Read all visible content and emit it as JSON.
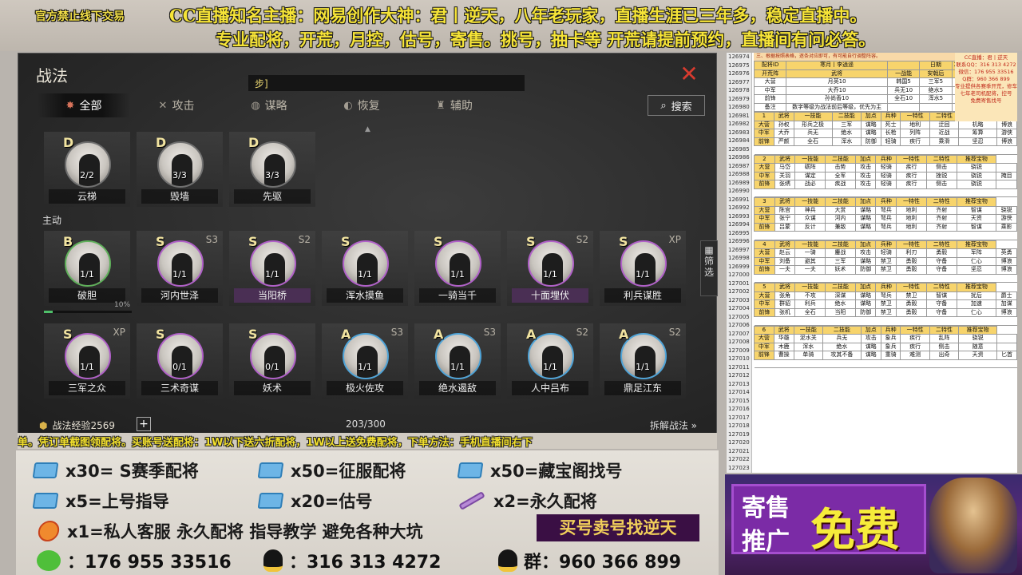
{
  "banner": {
    "small": "官方禁止线下交易",
    "line1": "CC直播知名主播：网易创作大神：君丨逆天，八年老玩家，直播生涯已三年多，稳定直播中。",
    "line2": "专业配将，开荒，月控，估号，寄售。挑号，抽卡等   开荒请提前预约，直播间有问必答。"
  },
  "game": {
    "title": "战法",
    "search_value": "步]",
    "tabs": [
      {
        "label": "全部",
        "icon": "all-icon"
      },
      {
        "label": "攻击",
        "icon": "swords-icon"
      },
      {
        "label": "谋略",
        "icon": "scroll-icon"
      },
      {
        "label": "恢复",
        "icon": "heal-icon"
      },
      {
        "label": "辅助",
        "icon": "support-icon"
      }
    ],
    "search_label": "搜索",
    "section_label": "主动",
    "filter_label": "筛选",
    "top_cards": [
      {
        "grade": "D",
        "count": "2/2",
        "name": "云梯"
      },
      {
        "grade": "D",
        "count": "3/3",
        "name": "毁墙"
      },
      {
        "grade": "D",
        "count": "3/3",
        "name": "先驱"
      }
    ],
    "row1": [
      {
        "grade": "B",
        "season": "",
        "count": "1/1",
        "name": "破胆",
        "progress": "10%"
      },
      {
        "grade": "S",
        "season": "S3",
        "count": "1/1",
        "name": "河内世泽"
      },
      {
        "grade": "S",
        "season": "S2",
        "count": "1/1",
        "name": "当阳桥"
      },
      {
        "grade": "S",
        "season": "",
        "count": "1/1",
        "name": "浑水摸鱼"
      },
      {
        "grade": "S",
        "season": "",
        "count": "1/1",
        "name": "一骑当千"
      },
      {
        "grade": "S",
        "season": "S2",
        "count": "1/1",
        "name": "十面埋伏"
      },
      {
        "grade": "S",
        "season": "XP",
        "count": "1/1",
        "name": "利兵谋胜"
      }
    ],
    "row2": [
      {
        "grade": "S",
        "season": "XP",
        "count": "1/1",
        "name": "三军之众"
      },
      {
        "grade": "S",
        "season": "",
        "count": "0/1",
        "name": "三术奇谋"
      },
      {
        "grade": "S",
        "season": "",
        "count": "0/1",
        "name": "妖术"
      },
      {
        "grade": "A",
        "season": "S3",
        "count": "1/1",
        "name": "极火佐攻"
      },
      {
        "grade": "A",
        "season": "S3",
        "count": "1/1",
        "name": "绝水遏敌"
      },
      {
        "grade": "A",
        "season": "S2",
        "count": "1/1",
        "name": "人中吕布"
      },
      {
        "grade": "A",
        "season": "S2",
        "count": "1/1",
        "name": "鼎足江东"
      }
    ],
    "exp_label": "战法经验2569",
    "capacity": "203/300",
    "dismantle": "拆解战法 »"
  },
  "ticker": "单。凭订单截图领配将。买账号送配将：1W以下送六折配将，1W以上送免费配将，下单方法：手机直播间右下",
  "promo": {
    "r1a": "x30= S赛季配将",
    "r1b": "x50=征服配将",
    "r1c": "x50=藏宝阁找号",
    "r2a": "x5=上号指导",
    "r2b": "x20=估号",
    "r2c": "x2=永久配将",
    "r3": "x1=私人客服 永久配将  指导教学 避免各种大坑",
    "badge": "买号卖号找逆天",
    "wechat": "：176 955 33516",
    "qq": "：316 313 4272",
    "group": "群：960 366 899"
  },
  "sheet": {
    "hdr": "三、根据按照表格，逐条对应即可，有可能自行调整阵容。",
    "rownums": [
      "126974",
      "126975",
      "126976",
      "126977",
      "126978",
      "126979",
      "126980",
      "126981",
      "126982",
      "126983",
      "126984",
      "126985",
      "126986",
      "126987",
      "126988",
      "126989",
      "126990",
      "126991",
      "126992",
      "126993",
      "126994",
      "126995",
      "126996",
      "126997",
      "126998",
      "126999",
      "127000",
      "127001",
      "127002",
      "127003",
      "127004",
      "127005",
      "127006",
      "127007",
      "127008",
      "127009",
      "127010",
      "127011",
      "127012",
      "127013",
      "127014",
      "127015",
      "127016",
      "127017",
      "127018",
      "127019",
      "127020",
      "127021",
      "127022",
      "127023"
    ],
    "promo_lines": [
      "CC直播：君丨逆天",
      "联系QQ：316 313 4272",
      "微信：176 955 33516",
      "Q群：960 366 899",
      "专业提供各赛季开荒，修车",
      "七年老司机配将，控号",
      "免费寄售找号"
    ],
    "top": [
      [
        "配将ID",
        "寒月丨李逍遥",
        "",
        "日期",
        "2023.4.21",
        ""
      ],
      [
        "开荒阵",
        "武将",
        "一战能",
        "安戟后",
        "加点",
        "赛季"
      ],
      [
        "大营",
        "月英10",
        "韩国5",
        "三军5",
        "谋略",
        ""
      ],
      [
        "中军",
        "大乔10",
        "兵无10",
        "绝水5",
        "谋略",
        "征服"
      ],
      [
        "前锋",
        "孙尚香10",
        "全石10",
        "浑水5",
        "防御",
        ""
      ],
      [
        "备注",
        "数字等级为战法前后等级，优先为主",
        "",
        "",
        "",
        ""
      ]
    ],
    "teams": [
      {
        "n": "1",
        "rows": [
          [
            "大营",
            "孙权",
            "形兵之极",
            "三军",
            "谋略",
            "死士",
            "地利",
            "迂回",
            "机略",
            "博浪"
          ],
          [
            "中军",
            "大乔",
            "兵无",
            "绝水",
            "谋略",
            "长枪",
            "列阵",
            "近战",
            "筹算",
            "游侠"
          ],
          [
            "前锋",
            "严颜",
            "全石",
            "浑水",
            "防御",
            "轻骑",
            "疾行",
            "乘滑",
            "坚忍",
            "博浪"
          ]
        ]
      },
      {
        "n": "2",
        "rows": [
          [
            "大营",
            "马岱",
            "砺阵",
            "击势",
            "攻击",
            "轻骑",
            "疾行",
            "侧击",
            "骁锐",
            ""
          ],
          [
            "中军",
            "关羽",
            "谋定",
            "全军",
            "攻击",
            "轻骑",
            "疾行",
            "挫锐",
            "骁锐",
            "掩目"
          ],
          [
            "前锋",
            "张绣",
            "战必",
            "疾战",
            "攻击",
            "轻骑",
            "疾行",
            "侧击",
            "骁锐",
            ""
          ]
        ]
      },
      {
        "n": "3",
        "rows": [
          [
            "大营",
            "陈宫",
            "神兵",
            "大赏",
            "谋略",
            "弩兵",
            "地利",
            "齐射",
            "智谋",
            "骁锐"
          ],
          [
            "中军",
            "张宁",
            "众谋",
            "河内",
            "谋略",
            "弩兵",
            "地利",
            "齐射",
            "天资",
            "游侠"
          ],
          [
            "前锋",
            "吕蒙",
            "反计",
            "兼敌",
            "谋略",
            "弩兵",
            "地利",
            "齐射",
            "智谋",
            "乘影"
          ]
        ]
      },
      {
        "n": "4",
        "rows": [
          [
            "大营",
            "赵云",
            "一骑",
            "鏖战",
            "攻击",
            "轻骑",
            "利刃",
            "勇毅",
            "军阵",
            "英勇"
          ],
          [
            "中军",
            "刘备",
            "避其",
            "三军",
            "谋略",
            "禁卫",
            "勇毅",
            "守备",
            "仁心",
            "博浪"
          ],
          [
            "前锋",
            "一夫",
            "一夫",
            "妖术",
            "防御",
            "禁卫",
            "勇毅",
            "守备",
            "坚忍",
            "博浪"
          ]
        ]
      },
      {
        "n": "5",
        "rows": [
          [
            "大营",
            "张角",
            "不攻",
            "深谋",
            "谋略",
            "弩兵",
            "禁卫",
            "智谋",
            "扰后",
            "爵士"
          ],
          [
            "中军",
            "群貂",
            "利兵",
            "绝水",
            "谋略",
            "禁卫",
            "勇毅",
            "守备",
            "加速",
            "加谋"
          ],
          [
            "前锋",
            "张机",
            "全石",
            "当阳",
            "防御",
            "禁卫",
            "勇毅",
            "守备",
            "仁心",
            "博浪"
          ]
        ]
      },
      {
        "n": "6",
        "rows": [
          [
            "大营",
            "华雄",
            "泥水关",
            "兵无",
            "攻击",
            "象兵",
            "疾行",
            "乱阵",
            "骁锐",
            ""
          ],
          [
            "中军",
            "木鹿",
            "浑水",
            "绝水",
            "谋略",
            "象兵",
            "疾行",
            "侧击",
            "随意",
            ""
          ],
          [
            "前锋",
            "曹操",
            "单骑",
            "攻其不备",
            "谋略",
            "重骑",
            "难测",
            "出奇",
            "天资",
            "匕首"
          ]
        ]
      }
    ]
  },
  "free_ad": {
    "jishou": "寄售",
    "tuiguang": "推广",
    "mianfei": "免费"
  },
  "colors": {
    "grade_s": "#b060c8",
    "grade_a": "#4fa4d8",
    "grade_b": "#5fb05a",
    "close": "#d63b2f",
    "banner_text": "#f6e437"
  }
}
